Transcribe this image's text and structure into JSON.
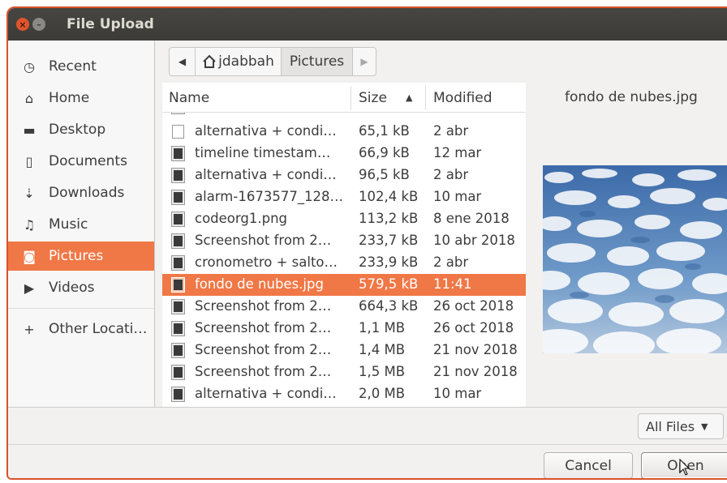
{
  "window": {
    "title": "File Upload"
  },
  "sidebar": {
    "items": [
      {
        "label": "Recent",
        "icon": "clock-icon",
        "glyph": "◷"
      },
      {
        "label": "Home",
        "icon": "home-icon",
        "glyph": "⌂"
      },
      {
        "label": "Desktop",
        "icon": "folder-icon",
        "glyph": "▬"
      },
      {
        "label": "Documents",
        "icon": "document-icon",
        "glyph": "▯"
      },
      {
        "label": "Downloads",
        "icon": "download-icon",
        "glyph": "⇣"
      },
      {
        "label": "Music",
        "icon": "music-icon",
        "glyph": "♫"
      },
      {
        "label": "Pictures",
        "icon": "camera-icon",
        "glyph": "◙"
      },
      {
        "label": "Videos",
        "icon": "video-icon",
        "glyph": "▶"
      },
      {
        "label": "Other Locati…",
        "icon": "plus-icon",
        "glyph": "+"
      }
    ],
    "active": "Pictures"
  },
  "pathbar": {
    "back_glyph": "◀",
    "home_label": "jdabbah",
    "current_label": "Pictures",
    "forward_glyph": "▶"
  },
  "columns": {
    "name": "Name",
    "size": "Size",
    "modified": "Modified",
    "sort_glyph": "▲"
  },
  "files": [
    {
      "name": "alternativa + condi…",
      "size": "65,1 kB",
      "modified": "2 abr",
      "type": "doc"
    },
    {
      "name": "timeline timestam…",
      "size": "66,9 kB",
      "modified": "12 mar",
      "type": "img"
    },
    {
      "name": "alternativa + condi…",
      "size": "96,5 kB",
      "modified": "2 abr",
      "type": "img"
    },
    {
      "name": "alarm-1673577_128…",
      "size": "102,4 kB",
      "modified": "10 mar",
      "type": "img"
    },
    {
      "name": "codeorg1.png",
      "size": "113,2 kB",
      "modified": "8 ene 2018",
      "type": "img"
    },
    {
      "name": "Screenshot from 2…",
      "size": "233,7 kB",
      "modified": "10 abr 2018",
      "type": "img"
    },
    {
      "name": "cronometro + salto…",
      "size": "233,9 kB",
      "modified": "2 abr",
      "type": "img"
    },
    {
      "name": "fondo de nubes.jpg",
      "size": "579,5 kB",
      "modified": "11:41",
      "type": "img",
      "selected": true
    },
    {
      "name": "Screenshot from 2…",
      "size": "664,3 kB",
      "modified": "26 oct 2018",
      "type": "img"
    },
    {
      "name": "Screenshot from 2…",
      "size": "1,1 MB",
      "modified": "26 oct 2018",
      "type": "img"
    },
    {
      "name": "Screenshot from 2…",
      "size": "1,4 MB",
      "modified": "21 nov 2018",
      "type": "img"
    },
    {
      "name": "Screenshot from 2…",
      "size": "1,5 MB",
      "modified": "21 nov 2018",
      "type": "img"
    },
    {
      "name": "alternativa + condi…",
      "size": "2,0 MB",
      "modified": "10 mar",
      "type": "img"
    }
  ],
  "preview": {
    "filename": "fondo de nubes.jpg"
  },
  "filter": {
    "label": "All Files",
    "glyph": "▼"
  },
  "buttons": {
    "cancel": "Cancel",
    "open": "Open"
  },
  "colors": {
    "accent": "#f07746",
    "titlebar": "#3c3b37",
    "close": "#e0542c"
  }
}
